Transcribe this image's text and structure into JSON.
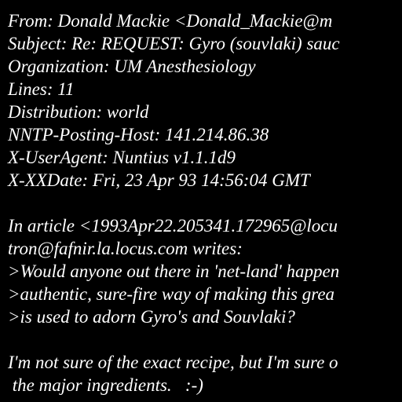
{
  "colors": {
    "background": "#000000",
    "text": "#ffffff"
  },
  "lines": [
    "From: Donald Mackie <Donald_Mackie@m",
    "Subject: Re: REQUEST: Gyro (souvlaki) sauc",
    "Organization: UM Anesthesiology",
    "Lines: 11",
    "Distribution: world",
    "NNTP-Posting-Host: 141.214.86.38",
    "X-UserAgent: Nuntius v1.1.1d9",
    "X-XXDate: Fri, 23 Apr 93 14:56:04 GMT",
    "",
    "In article <1993Apr22.205341.172965@locu",
    "tron@fafnir.la.locus.com writes:",
    ">Would anyone out there in 'net-land' happen",
    ">authentic, sure-fire way of making this grea",
    ">is used to adorn Gyro's and Souvlaki?",
    "",
    "I'm not sure of the exact recipe, but I'm sure o",
    " the major ingredients.   :-)"
  ]
}
